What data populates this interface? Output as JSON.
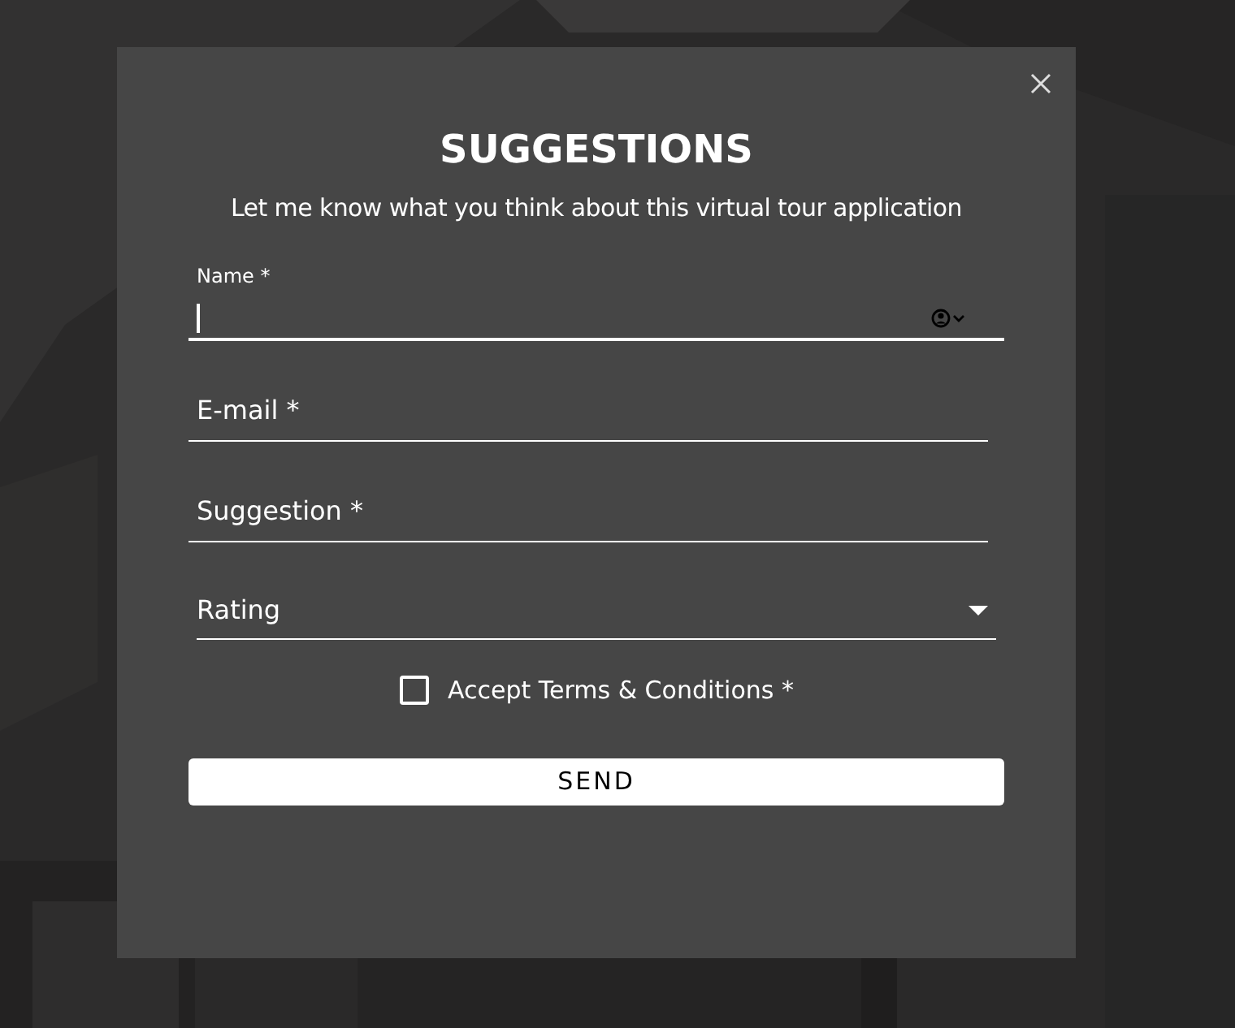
{
  "dialog": {
    "title": "SUGGESTIONS",
    "subtitle": "Let me know what you think about this virtual tour application",
    "fields": [
      {
        "kind": "text",
        "label": "Name *",
        "focused": true
      },
      {
        "kind": "text",
        "label": "E-mail *",
        "focused": false
      },
      {
        "kind": "text",
        "label": "Suggestion *",
        "focused": false
      },
      {
        "kind": "select",
        "label": "Rating",
        "focused": false
      }
    ],
    "terms": {
      "label": "Accept Terms & Conditions *",
      "checked": false
    },
    "send_button": "SEND"
  }
}
